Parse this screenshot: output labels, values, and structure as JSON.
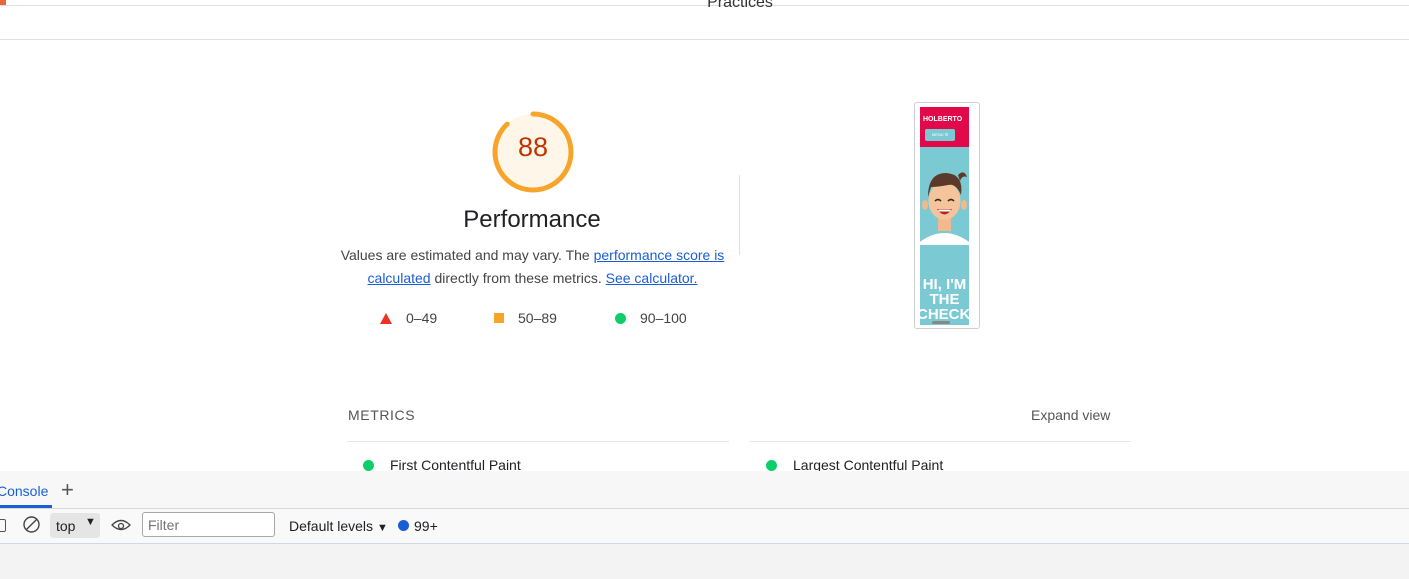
{
  "report": {
    "tab_title": "Practices",
    "category_title": "Performance",
    "score": "88",
    "score_fraction": 0.88,
    "description": {
      "prefix": "Values are estimated and may vary. The ",
      "link1": "performance score is calculated",
      "middle": " directly from these metrics. ",
      "link2": "See calculator."
    },
    "legend": [
      {
        "range": "0–49",
        "shape": "triangle-icon",
        "color": "#eb3323"
      },
      {
        "range": "50–89",
        "shape": "square-icon",
        "color": "#f6a42a"
      },
      {
        "range": "90–100",
        "shape": "circle-icon",
        "color": "#0cce6b"
      }
    ],
    "gauge_color": "#f6a42a",
    "score_text_color": "#c33300"
  },
  "screenshot": {
    "brand": "HOLBERTO",
    "button": "MENU ☰",
    "headline": "HI, I'M THE CHECKE"
  },
  "metrics": {
    "title": "METRICS",
    "expand": "Expand view",
    "items": [
      {
        "label": "First Contentful Paint",
        "color": "#0cce6b"
      },
      {
        "label": "Largest Contentful Paint",
        "color": "#0cce6b"
      }
    ]
  },
  "devtools": {
    "tab_console": "Console",
    "add_tab": "+",
    "context": "top",
    "filter_placeholder": "Filter",
    "levels": "Default levels",
    "issues": "99+"
  }
}
